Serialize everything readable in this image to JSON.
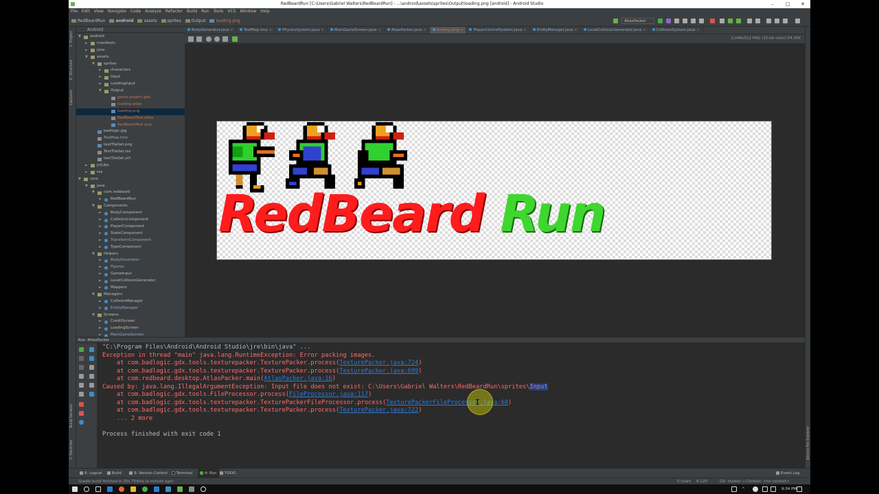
{
  "window": {
    "title": "RedBeardRun [C:\\Users\\Gabriel Walters\\RedBeardRun] - ...\\android\\assets\\sprites\\Output\\loading.png [android] - Android Studio",
    "minimize": "–",
    "maximize": "□",
    "close": "✕"
  },
  "menu": [
    "File",
    "Edit",
    "View",
    "Navigate",
    "Code",
    "Analyze",
    "Refactor",
    "Build",
    "Run",
    "Tools",
    "VCS",
    "Window",
    "Help"
  ],
  "breadcrumb": [
    "RedBeardRun",
    "android",
    "assets",
    "sprites",
    "Output",
    "loading.png"
  ],
  "run_config": "AtlasPacker",
  "project_panel": {
    "selector": "Android"
  },
  "side_tabs": {
    "project": "1: Project",
    "structure": "Z: Structure",
    "captures": "Captures",
    "build_variants": "Build Variants",
    "favorites": "2: Favorites",
    "device_explorer": "Device File Explorer"
  },
  "tree": [
    {
      "label": "android",
      "depth": 0,
      "arrow": "▼",
      "icon": "folder",
      "color": "#bbbbbb"
    },
    {
      "label": "manifests",
      "depth": 1,
      "arrow": "►",
      "icon": "folder",
      "color": "#bbbbbb"
    },
    {
      "label": "java",
      "depth": 1,
      "arrow": "►",
      "icon": "folder",
      "color": "#bbbbbb"
    },
    {
      "label": "assets",
      "depth": 1,
      "arrow": "▼",
      "icon": "folder",
      "color": "#bbbbbb"
    },
    {
      "label": "sprites",
      "depth": 2,
      "arrow": "▼",
      "icon": "folder",
      "color": "#bbbbbb"
    },
    {
      "label": "characters",
      "depth": 3,
      "arrow": "►",
      "icon": "folder",
      "color": "#bbbbbb"
    },
    {
      "label": "Input",
      "depth": 3,
      "arrow": "►",
      "icon": "folder",
      "color": "#bbbbbb"
    },
    {
      "label": "LoadingInput",
      "depth": 3,
      "arrow": "►",
      "icon": "folder",
      "color": "#bbbbbb"
    },
    {
      "label": "Output",
      "depth": 3,
      "arrow": "▼",
      "icon": "folder",
      "color": "#bbbbbb"
    },
    {
      "label": "game.project.gdx",
      "depth": 4,
      "arrow": "",
      "icon": "file",
      "color": "#c6735b"
    },
    {
      "label": "loading.atlas",
      "depth": 4,
      "arrow": "",
      "icon": "file",
      "color": "#c6735b"
    },
    {
      "label": "loading.png",
      "depth": 4,
      "arrow": "",
      "icon": "img",
      "color": "#c6735b",
      "selected": true
    },
    {
      "label": "RedBeardTest.atlas",
      "depth": 4,
      "arrow": "",
      "icon": "file",
      "color": "#c6735b"
    },
    {
      "label": "RedBeardTest.png",
      "depth": 4,
      "arrow": "",
      "icon": "img",
      "color": "#c6735b"
    },
    {
      "label": "badlogic.jpg",
      "depth": 2,
      "arrow": "",
      "icon": "img",
      "color": "#bbbbbb"
    },
    {
      "label": "TestMap.tmx",
      "depth": 2,
      "arrow": "",
      "icon": "file",
      "color": "#8fa9c6"
    },
    {
      "label": "testTileSet.png",
      "depth": 2,
      "arrow": "",
      "icon": "img",
      "color": "#bbbbbb"
    },
    {
      "label": "TestTileSet.tsx",
      "depth": 2,
      "arrow": "",
      "icon": "file",
      "color": "#bbbbbb"
    },
    {
      "label": "testTileSet.xcf",
      "depth": 2,
      "arrow": "",
      "icon": "file",
      "color": "#bbbbbb"
    },
    {
      "label": "jniLibs",
      "depth": 1,
      "arrow": "►",
      "icon": "folder",
      "color": "#bbbbbb"
    },
    {
      "label": "res",
      "depth": 1,
      "arrow": "►",
      "icon": "folder",
      "color": "#bbbbbb"
    },
    {
      "label": "core",
      "depth": 0,
      "arrow": "▼",
      "icon": "folder",
      "color": "#bbbbbb"
    },
    {
      "label": "java",
      "depth": 1,
      "arrow": "▼",
      "icon": "folder",
      "color": "#bbbbbb"
    },
    {
      "label": "com.redbeard",
      "depth": 2,
      "arrow": "▼",
      "icon": "folder",
      "color": "#bbbbbb"
    },
    {
      "label": "RedBeardRun",
      "depth": 3,
      "arrow": "►",
      "icon": "class",
      "color": "#bbbbbb"
    },
    {
      "label": "Components",
      "depth": 2,
      "arrow": "▼",
      "icon": "folder",
      "color": "#bbbbbb"
    },
    {
      "label": "BodyComponent",
      "depth": 3,
      "arrow": "►",
      "icon": "class",
      "color": "#bbbbbb"
    },
    {
      "label": "CollisionComponent",
      "depth": 3,
      "arrow": "►",
      "icon": "class",
      "color": "#bbbbbb"
    },
    {
      "label": "PlayerComponent",
      "depth": 3,
      "arrow": "►",
      "icon": "class",
      "color": "#bbbbbb"
    },
    {
      "label": "StateComponent",
      "depth": 3,
      "arrow": "►",
      "icon": "class",
      "color": "#bbbbbb"
    },
    {
      "label": "TransformComponent",
      "depth": 3,
      "arrow": "►",
      "icon": "class",
      "color": "#8fa9c6"
    },
    {
      "label": "TypeComponent",
      "depth": 3,
      "arrow": "►",
      "icon": "class",
      "color": "#bbbbbb"
    },
    {
      "label": "Helpers",
      "depth": 2,
      "arrow": "▼",
      "icon": "folder",
      "color": "#bbbbbb"
    },
    {
      "label": "BodyGenerator",
      "depth": 3,
      "arrow": "►",
      "icon": "class",
      "color": "#8fa9c6"
    },
    {
      "label": "Figures",
      "depth": 3,
      "arrow": "►",
      "icon": "class",
      "color": "#8fa9c6"
    },
    {
      "label": "GameInput",
      "depth": 3,
      "arrow": "►",
      "icon": "class",
      "color": "#bbbbbb"
    },
    {
      "label": "LevelCollisionGenerator",
      "depth": 3,
      "arrow": "►",
      "icon": "class",
      "color": "#bbbbbb"
    },
    {
      "label": "Mappers",
      "depth": 3,
      "arrow": "►",
      "icon": "class",
      "color": "#bbbbbb"
    },
    {
      "label": "Managers",
      "depth": 2,
      "arrow": "▼",
      "icon": "folder",
      "color": "#bbbbbb"
    },
    {
      "label": "CollisionManager",
      "depth": 3,
      "arrow": "►",
      "icon": "class",
      "color": "#bbbbbb"
    },
    {
      "label": "EntityManager",
      "depth": 3,
      "arrow": "►",
      "icon": "class",
      "color": "#8fa9c6"
    },
    {
      "label": "Screens",
      "depth": 2,
      "arrow": "▼",
      "icon": "folder",
      "color": "#bbbbbb"
    },
    {
      "label": "CreditScreen",
      "depth": 3,
      "arrow": "►",
      "icon": "class",
      "color": "#bbbbbb"
    },
    {
      "label": "LoadingScreen",
      "depth": 3,
      "arrow": "►",
      "icon": "class",
      "color": "#bbbbbb"
    },
    {
      "label": "MainGameScreen",
      "depth": 3,
      "arrow": "►",
      "icon": "class",
      "color": "#8fa9c6"
    }
  ],
  "editor_tabs": [
    {
      "label": "BodyGenerator.java",
      "active": false
    },
    {
      "label": "TestMap.tmx",
      "active": false
    },
    {
      "label": "PhysicsSystem.java",
      "active": false
    },
    {
      "label": "MainGameScreen.java",
      "active": false
    },
    {
      "label": "AtlasPacker.java",
      "active": false
    },
    {
      "label": "loading.png",
      "active": true
    },
    {
      "label": "PlayerControlSystem.java",
      "active": false
    },
    {
      "label": "EntityManager.java",
      "active": false
    },
    {
      "label": "LevelCollisionGenerator.java",
      "active": false
    },
    {
      "label": "CollisionSystem.java",
      "active": false
    }
  ],
  "image_info": "2,048x512 PNG (32-bit color) 54.35K",
  "image_text": {
    "red": "RedBeard",
    "green": "Run"
  },
  "colors": {
    "logo_red": "#ff1c1c",
    "logo_green": "#3fd62f",
    "error": "#ff6b68",
    "link": "#287bde"
  },
  "run_panel": {
    "tab": "Run",
    "config": "AtlasPacker"
  },
  "console": [
    [
      {
        "t": "\"C:\\Program Files\\Android\\Android Studio\\jre\\bin\\java\" ...",
        "c": "gray"
      }
    ],
    [
      {
        "t": "Exception in thread \"main\" java.lang.RuntimeException: Error packing images.",
        "c": "red"
      }
    ],
    [
      {
        "t": "\tat com.badlogic.gdx.tools.texturepacker.TexturePacker.process(",
        "c": "red"
      },
      {
        "t": "TexturePacker.java:724",
        "c": "link"
      },
      {
        "t": ")",
        "c": "red"
      }
    ],
    [
      {
        "t": "\tat com.badlogic.gdx.tools.texturepacker.TexturePacker.process(",
        "c": "red"
      },
      {
        "t": "TexturePacker.java:699",
        "c": "link"
      },
      {
        "t": ")",
        "c": "red"
      }
    ],
    [
      {
        "t": "\tat com.redbeard.desktop.AtlasPacker.main(",
        "c": "red"
      },
      {
        "t": "AtlasPacker.java:16",
        "c": "link"
      },
      {
        "t": ")",
        "c": "red"
      }
    ],
    [
      {
        "t": "Caused by: java.lang.IllegalArgumentException: Input file does not exist: C:\\Users\\Gabriel Walters\\RedBeardRun\\sprites\\",
        "c": "red"
      },
      {
        "t": "Input",
        "c": "hl"
      }
    ],
    [
      {
        "t": "\tat com.badlogic.gdx.tools.FileProcessor.process(",
        "c": "red"
      },
      {
        "t": "FileProcessor.java:117",
        "c": "link"
      },
      {
        "t": ")",
        "c": "red"
      }
    ],
    [
      {
        "t": "\tat com.badlogic.gdx.tools.texturepacker.TexturePackerFileProcessor.process(",
        "c": "red"
      },
      {
        "t": "TexturePackerFileProcessor.java:68",
        "c": "link"
      },
      {
        "t": ")",
        "c": "red"
      }
    ],
    [
      {
        "t": "\tat com.badlogic.gdx.tools.texturepacker.TexturePacker.process(",
        "c": "red"
      },
      {
        "t": "TexturePacker.java:722",
        "c": "link"
      },
      {
        "t": ")",
        "c": "red"
      }
    ],
    [
      {
        "t": "\t... 2 more",
        "c": "red"
      }
    ],
    [
      {
        "t": "",
        "c": "white"
      }
    ],
    [
      {
        "t": "Process finished with exit code 1",
        "c": "white"
      }
    ]
  ],
  "bottom_tabs": [
    "6: Logcat",
    "Build",
    "9: Version Control",
    "Terminal",
    "4: Run",
    "TODO"
  ],
  "event_log": "Event Log",
  "status": {
    "left": "Gradle build finished in 25s 754ms (a minute ago)",
    "chars": "5 chars",
    "pos": "6:120",
    "git": "Git: master ÷",
    "context": "Context: <no context>"
  },
  "taskbar": {
    "time": "9:34 PM"
  }
}
